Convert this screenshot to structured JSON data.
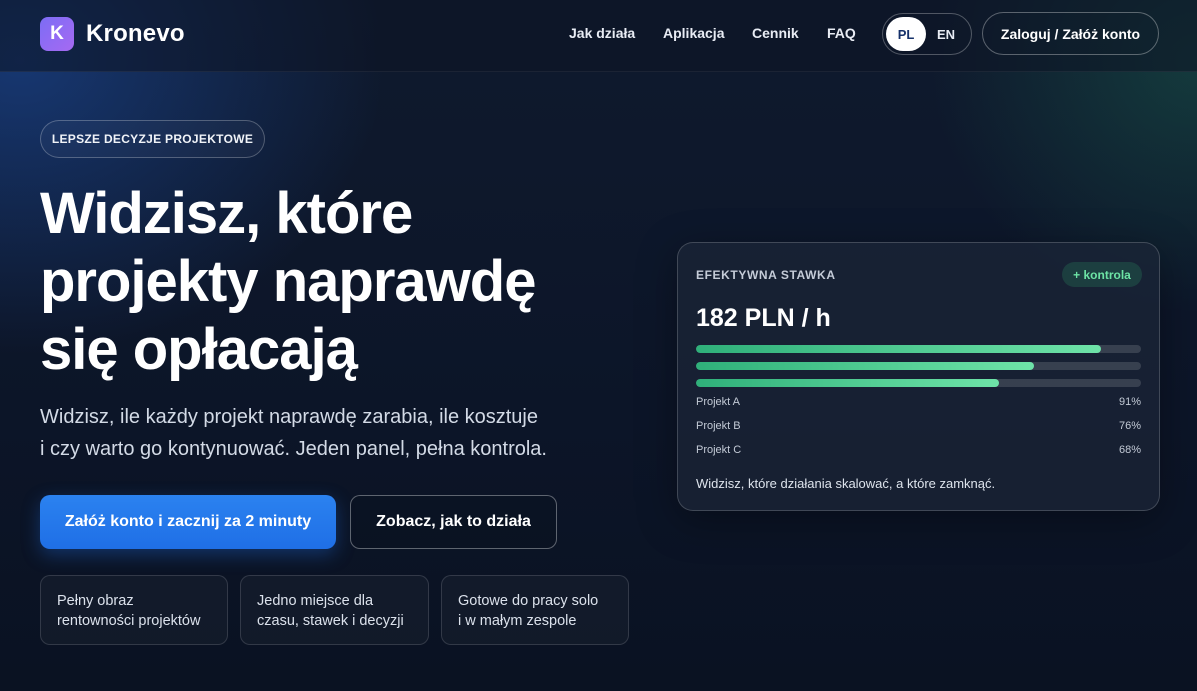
{
  "brand": {
    "logo_letter": "K",
    "name": "Kronevo"
  },
  "nav": {
    "items": [
      {
        "label": "Jak działa"
      },
      {
        "label": "Aplikacja"
      },
      {
        "label": "Cennik"
      },
      {
        "label": "FAQ"
      }
    ],
    "lang": {
      "active": "PL",
      "other": "EN"
    },
    "login_label": "Zaloguj / Załóż konto"
  },
  "hero": {
    "badge": "LEPSZE DECYZJE PROJEKTOWE",
    "headline_lines": [
      "Widzisz, które",
      "projekty naprawdę",
      "się opłacają"
    ],
    "sub_lines": [
      "Widzisz, ile każdy projekt naprawdę zarabia, ile kosztuje",
      "i czy warto go kontynuować. Jeden panel, pełna kontrola."
    ],
    "cta_primary": "Załóż konto i zacznij za 2 minuty",
    "cta_secondary": "Zobacz, jak to działa",
    "features": [
      {
        "line1": "Pełny obraz",
        "line2": "rentowności projektów"
      },
      {
        "line1": "Jedno miejsce dla",
        "line2": "czasu, stawek i decyzji"
      },
      {
        "line1": "Gotowe do pracy solo",
        "line2": "i w małym zespole"
      }
    ]
  },
  "card": {
    "label": "EFEKTYWNA STAWKA",
    "pill": "+ kontrola",
    "value": "182 PLN / h",
    "projects": [
      {
        "name": "Projekt A",
        "pct_label": "91%",
        "progress": 0.91
      },
      {
        "name": "Projekt B",
        "pct_label": "76%",
        "progress": 0.76
      },
      {
        "name": "Projekt C",
        "pct_label": "68%",
        "progress": 0.68
      }
    ],
    "note": "Widzisz, które działania skalować, a które zamknąć."
  },
  "colors": {
    "background": "#0b1324",
    "primary": "#1f6fe6",
    "accent_green": "#6de3a5",
    "logo": "#8b6cf3"
  }
}
